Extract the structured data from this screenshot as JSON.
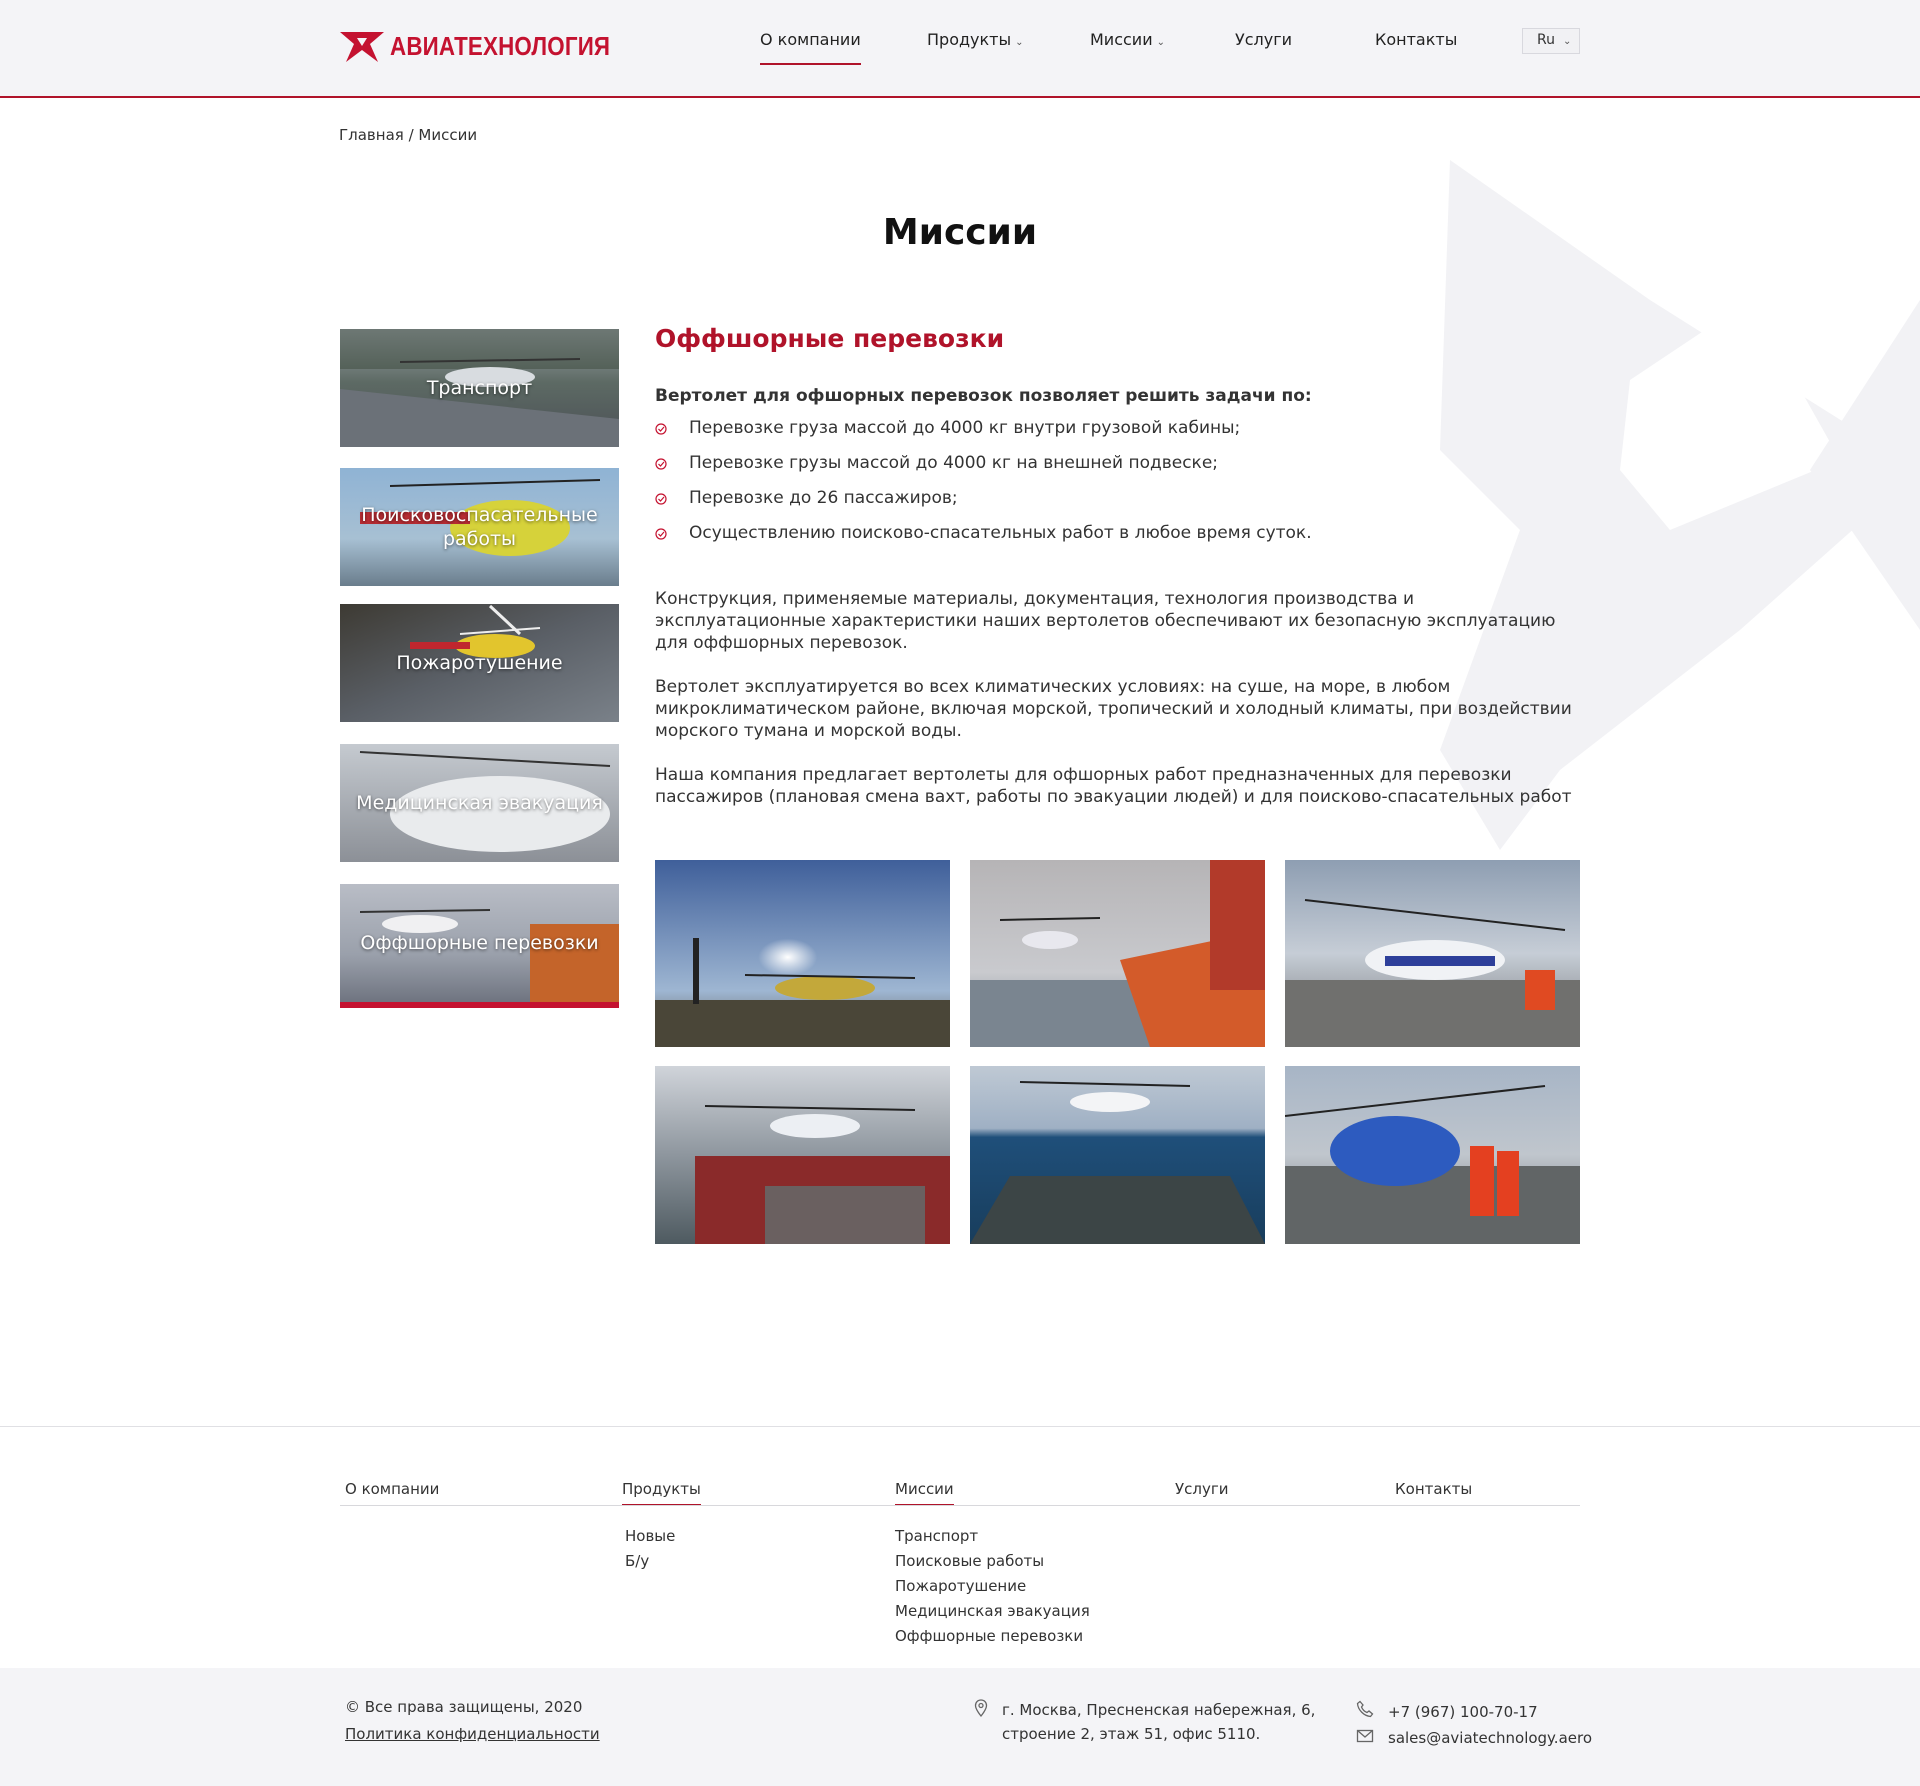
{
  "header": {
    "logo_text": "АВИАТЕХНОЛОГИЯ",
    "nav": [
      {
        "label": "О компании"
      },
      {
        "label": "Продукты"
      },
      {
        "label": "Миссии"
      },
      {
        "label": "Услуги"
      },
      {
        "label": "Контакты"
      }
    ],
    "lang": "Ru"
  },
  "breadcrumb": {
    "home": "Главная",
    "sep": "/",
    "current": "Миссии"
  },
  "page_title": "Миссии",
  "sidebar": {
    "items": [
      {
        "label": "Транспорт"
      },
      {
        "label": "Поисковоспасательные работы"
      },
      {
        "label": "Пожаротушение"
      },
      {
        "label": "Медицинская эвакуация"
      },
      {
        "label": "Оффшорные перевозки"
      }
    ]
  },
  "content": {
    "title": "Оффшорные перевозки",
    "lead": "Вертолет для офшорных перевозок позволяет решить задачи по:",
    "bullets": [
      "Перевозке груза массой до 4000 кг внутри грузовой кабины;",
      "Перевозке грузы массой до 4000 кг на внешней подвеске;",
      "Перевозке до 26 пассажиров;",
      "Осуществлению поисково-спасательных работ в любое время суток."
    ],
    "paragraphs": [
      "Конструкция, применяемые материалы, документация, технология производства и эксплуатационные характеристики наших вертолетов  обеспечивают их безопасную эксплуатацию для оффшорных перевозок.",
      "Вертолет эксплуатируется во всех климатических условиях: на суше, на море, в любом микроклиматическом районе, включая морской, тропический и холодный климаты, при воздействии морского тумана и морской воды.",
      "Наша компания предлагает вертолеты для офшорных работ  предназначенных для перевозки пассажиров (плановая смена вахт, работы по эвакуации людей) и для поисково-спасательных работ"
    ]
  },
  "footer": {
    "columns": [
      {
        "head": "О компании",
        "links": []
      },
      {
        "head": "Продукты",
        "links": [
          "Новые",
          "Б/у"
        ]
      },
      {
        "head": "Миссии",
        "links": [
          "Транспорт",
          "Поисковые работы",
          "Пожаротушение",
          "Медицинская эвакуация",
          "Оффшорные перевозки"
        ]
      },
      {
        "head": "Услуги",
        "links": []
      },
      {
        "head": "Контакты",
        "links": []
      }
    ],
    "copyright": "© Все права защищены, 2020",
    "privacy": "Политика конфиденциальности",
    "address_line1": "г. Москва, Пресненская набережная, 6,",
    "address_line2": "строение 2, этаж 51, офис 5110.",
    "phone": "+7 (967) 100-70-17",
    "email": "sales@aviatechnology.aero"
  },
  "colors": {
    "accent": "#b0132a",
    "header_bg": "#f4f4f7"
  }
}
